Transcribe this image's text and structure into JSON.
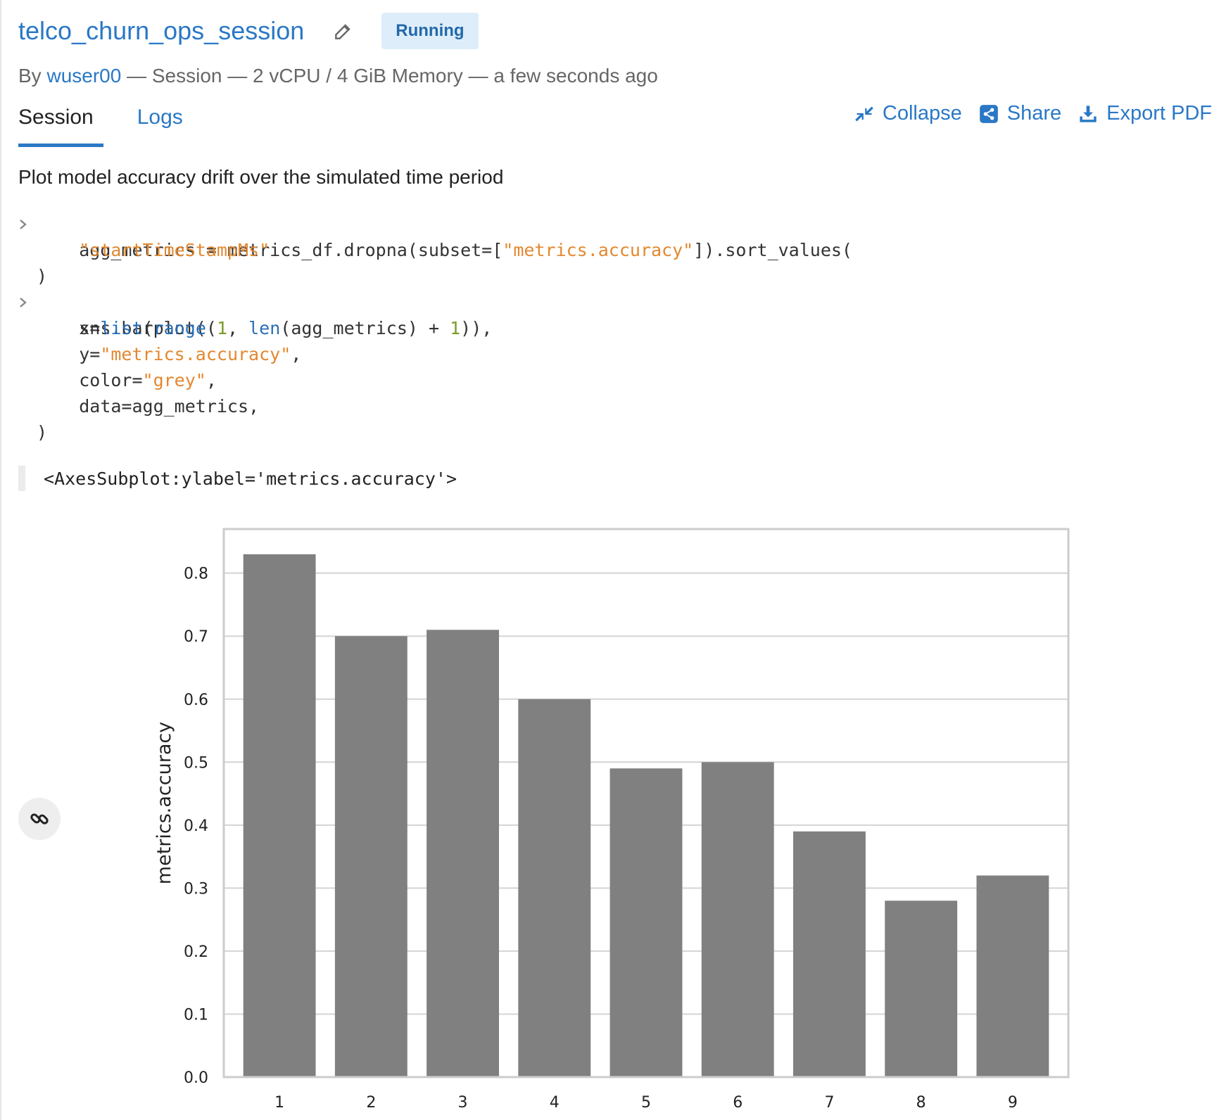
{
  "header": {
    "title": "telco_churn_ops_session",
    "status": "Running",
    "meta_prefix": "By ",
    "user": "wuser00",
    "meta_suffix": " — Session — 2 vCPU / 4 GiB Memory — a few seconds ago"
  },
  "tabs": [
    {
      "label": "Session"
    },
    {
      "label": "Logs"
    }
  ],
  "actions": {
    "collapse": "Collapse",
    "share": "Share",
    "export": "Export PDF"
  },
  "cell": {
    "description": "Plot model accuracy drift over the simulated time period",
    "code": {
      "l1a": "agg_metrics = metrics_df.dropna(subset=[",
      "l1b": "\"metrics.accuracy\"",
      "l1c": "]).sort_values(",
      "l2": "\"startTimeStampMs\"",
      "l3": ")",
      "l4": "sns.barplot(",
      "l5a": "x=",
      "l5b": "list",
      "l5c": "(",
      "l5d": "range",
      "l5e": "(",
      "l5f": "1",
      "l5g": ", ",
      "l5h": "len",
      "l5i": "(agg_metrics) + ",
      "l5j": "1",
      "l5k": ")),",
      "l6a": "y=",
      "l6b": "\"metrics.accuracy\"",
      "l6c": ",",
      "l7a": "color=",
      "l7b": "\"grey\"",
      "l7c": ",",
      "l8": "data=agg_metrics,",
      "l9": ")"
    },
    "output": "<AxesSubplot:ylabel='metrics.accuracy'>"
  },
  "colors": {
    "accent": "#2a78c6",
    "bar": "#808080",
    "string": "#e3882f"
  },
  "chart_data": {
    "type": "bar",
    "categories": [
      "1",
      "2",
      "3",
      "4",
      "5",
      "6",
      "7",
      "8",
      "9"
    ],
    "values": [
      0.83,
      0.7,
      0.71,
      0.6,
      0.49,
      0.5,
      0.39,
      0.28,
      0.32
    ],
    "ylabel": "metrics.accuracy",
    "xlabel": "",
    "ylim": [
      0,
      0.87
    ],
    "yticks": [
      "0.0",
      "0.1",
      "0.2",
      "0.3",
      "0.4",
      "0.5",
      "0.6",
      "0.7",
      "0.8"
    ],
    "grid": true,
    "bar_color": "#808080"
  }
}
